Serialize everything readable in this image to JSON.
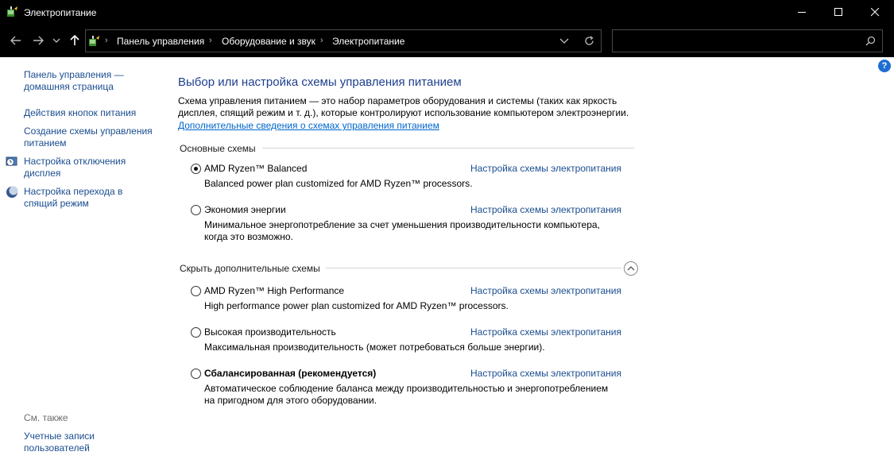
{
  "window": {
    "title": "Электропитание"
  },
  "address": {
    "crumbs": [
      "Панель управления",
      "Оборудование и звук",
      "Электропитание"
    ]
  },
  "search": {
    "value": ""
  },
  "sidebar": {
    "home_link": "Панель управления —\nдомашняя страница",
    "links": [
      "Действия кнопок питания",
      "Создание схемы управления питанием",
      "Настройка отключения дисплея",
      "Настройка перехода в спящий режим"
    ],
    "see_also_title": "См. также",
    "see_also_links": [
      "Учетные записи пользователей"
    ]
  },
  "main": {
    "title": "Выбор или настройка схемы управления питанием",
    "intro": "Схема управления питанием — это набор параметров оборудования и системы (таких как яркость дисплея, спящий режим и т. д.), которые контролируют использование компьютером электроэнергии.",
    "intro_link": "Дополнительные сведения о схемах управления питанием",
    "group_main": "Основные схемы",
    "group_hidden": "Скрыть дополнительные схемы",
    "plan_link_label": "Настройка схемы электропитания",
    "plans": [
      {
        "name": "AMD Ryzen™ Balanced",
        "description": "Balanced power plan customized for AMD Ryzen™ processors.",
        "selected": true
      },
      {
        "name": "Экономия энергии",
        "description": "Минимальное энергопотребление за счет уменьшения производительности компьютера, когда это возможно.",
        "selected": false
      },
      {
        "name": "AMD Ryzen™ High Performance",
        "description": "High performance power plan customized for AMD Ryzen™ processors.",
        "selected": false
      },
      {
        "name": "Высокая производительность",
        "description": "Максимальная производительность (может потребоваться больше энергии).",
        "selected": false
      },
      {
        "name": "Сбалансированная (рекомендуется)",
        "description": "Автоматическое соблюдение баланса между производительностью и энергопотреблением на пригодном для этого оборудовании.",
        "selected": false
      }
    ]
  },
  "help_label": "?",
  "colors": {
    "link": "#1a4d8f",
    "title": "#1e3f8e",
    "chrome": "#000000"
  }
}
